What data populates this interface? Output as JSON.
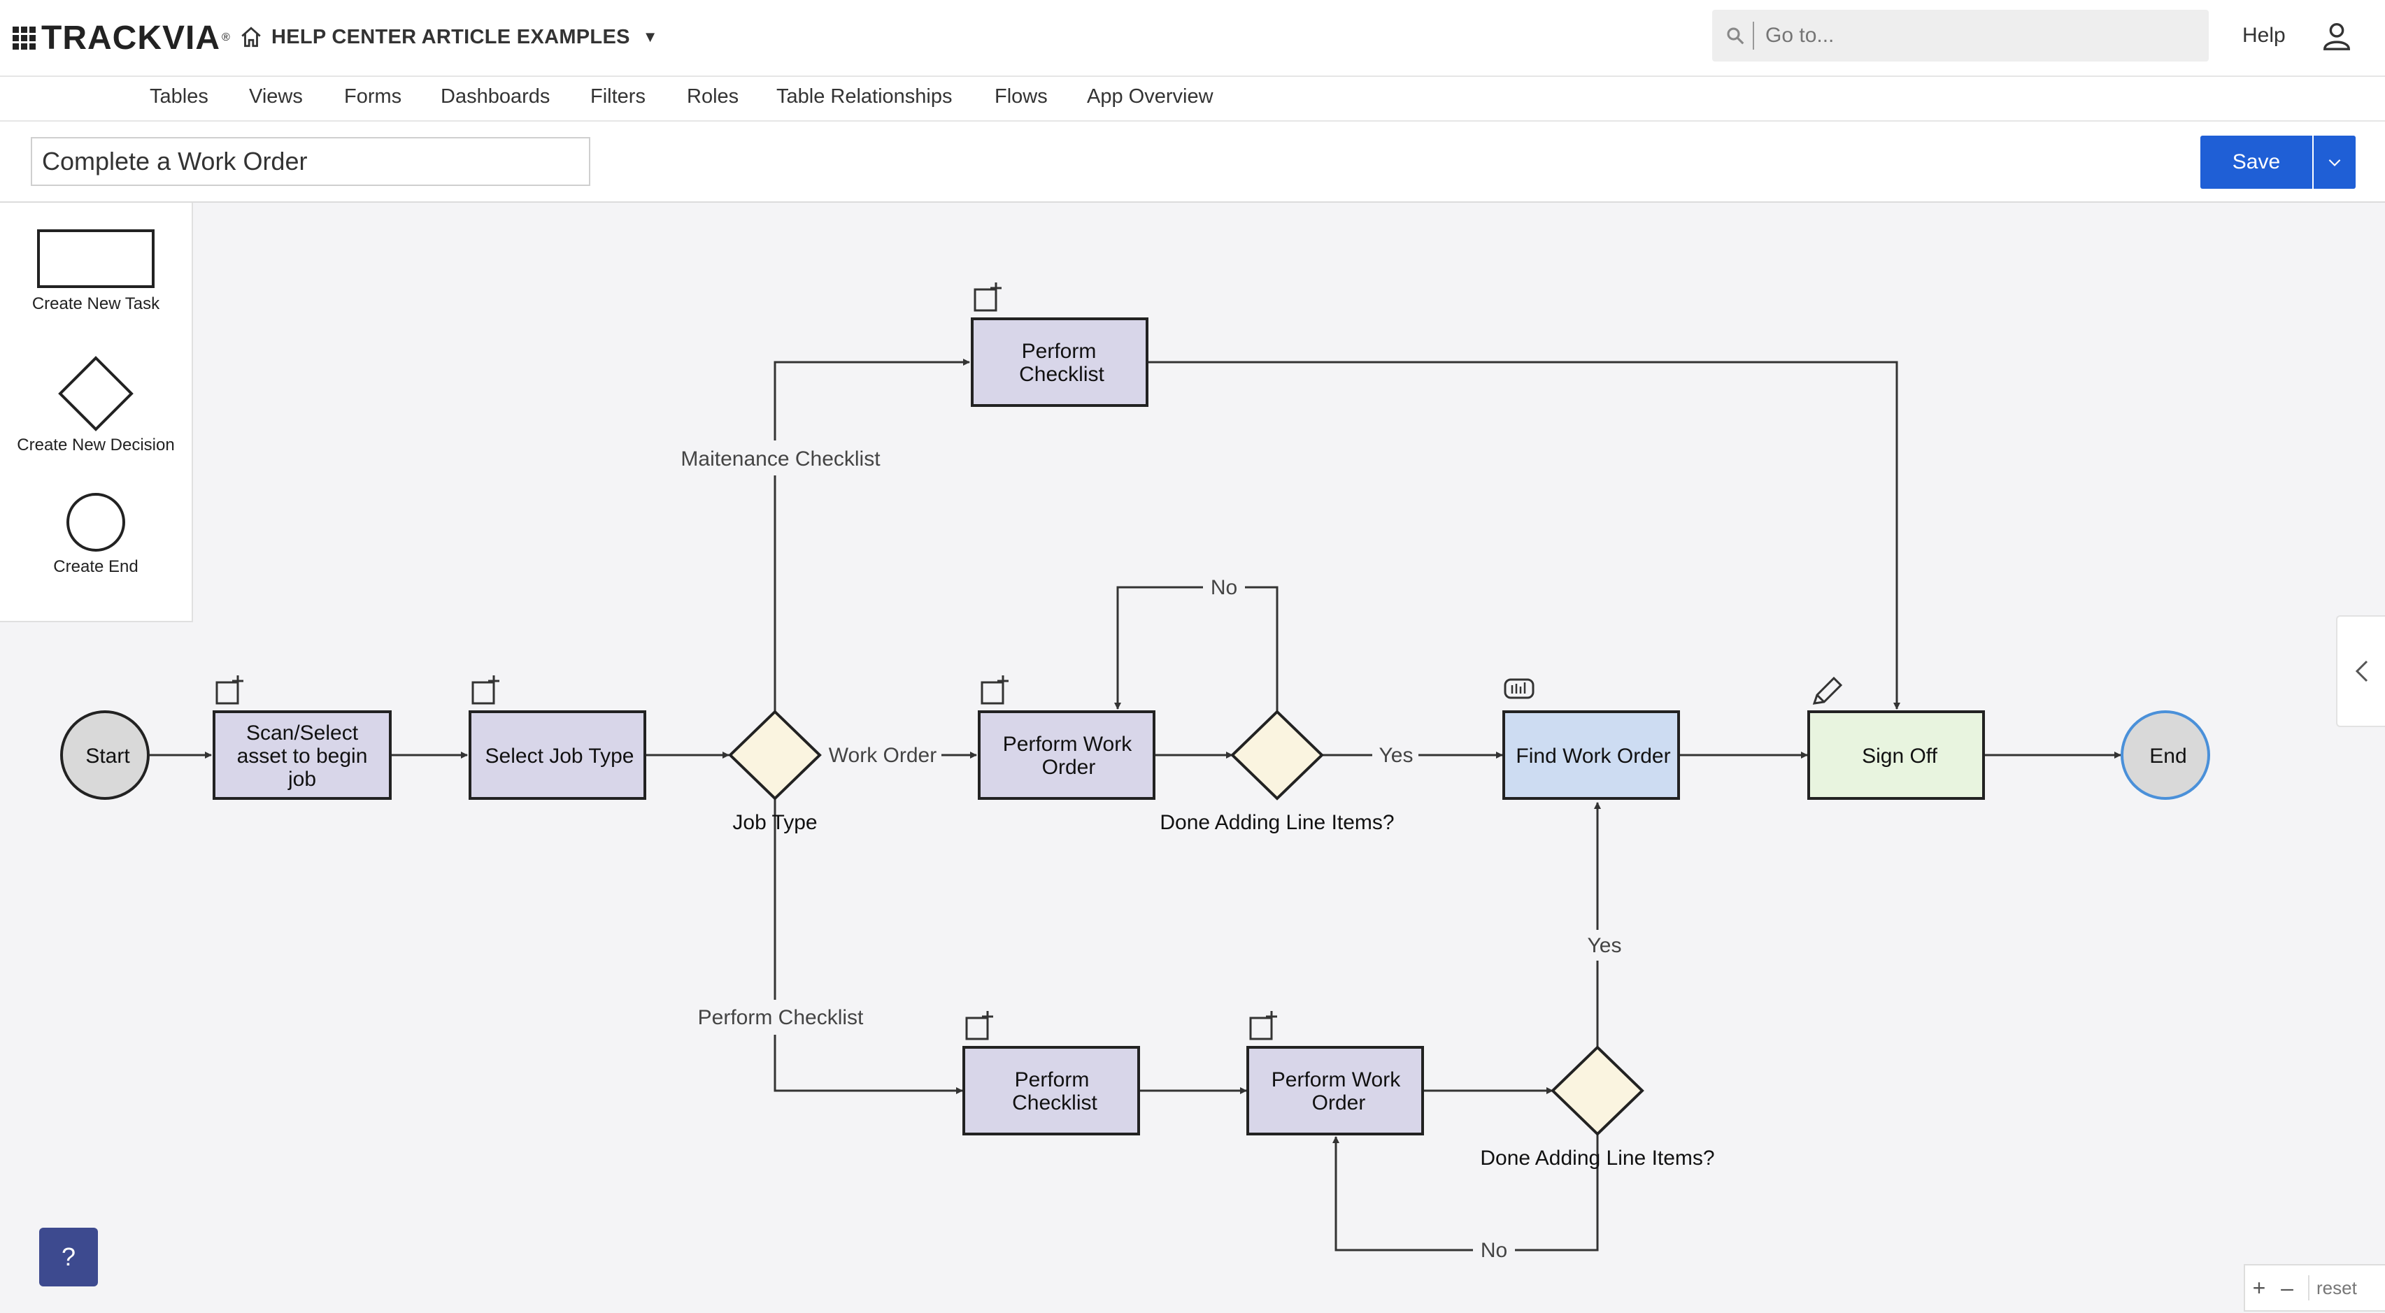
{
  "header": {
    "brand": "TRACKVIA",
    "app_name": "HELP CENTER ARTICLE EXAMPLES",
    "search_placeholder": "Go to...",
    "help": "Help"
  },
  "nav": {
    "items": [
      "Tables",
      "Views",
      "Forms",
      "Dashboards",
      "Filters",
      "Roles",
      "Table Relationships",
      "Flows",
      "App Overview"
    ]
  },
  "flow": {
    "name": "Complete a Work Order",
    "save_label": "Save"
  },
  "palette": {
    "task": "Create New Task",
    "decision": "Create New Decision",
    "end": "Create End"
  },
  "diagram": {
    "nodes": {
      "start": "Start",
      "scan": [
        "Scan/Select",
        "asset to begin",
        "job"
      ],
      "select_job": "Select Job Type",
      "job_type": "Job Type",
      "perform_checklist_top": [
        "Perform",
        "Checklist"
      ],
      "perform_work_order_mid": [
        "Perform Work",
        "Order"
      ],
      "done_mid": "Done Adding Line Items?",
      "find_work_order": "Find Work Order",
      "sign_off": "Sign Off",
      "end": "End",
      "perform_checklist_bottom": [
        "Perform",
        "Checklist"
      ],
      "perform_work_order_bottom": [
        "Perform Work",
        "Order"
      ],
      "done_bottom": "Done Adding Line Items?"
    },
    "edges": {
      "maintenance": "Maitenance Checklist",
      "work_order": "Work Order",
      "perform_checklist": "Perform Checklist",
      "no_mid": "No",
      "yes_mid": "Yes",
      "yes_bottom": "Yes",
      "no_bottom": "No"
    },
    "colors": {
      "task": "#d8d6e9",
      "decision": "#faf4e0",
      "find": "#cddcf2",
      "signoff": "#e8f4df",
      "start": "#d9d9d9",
      "end_border": "#4a90d9"
    }
  },
  "controls": {
    "help_fab": "?",
    "zoom_in": "+",
    "zoom_out": "–",
    "reset": "reset"
  }
}
